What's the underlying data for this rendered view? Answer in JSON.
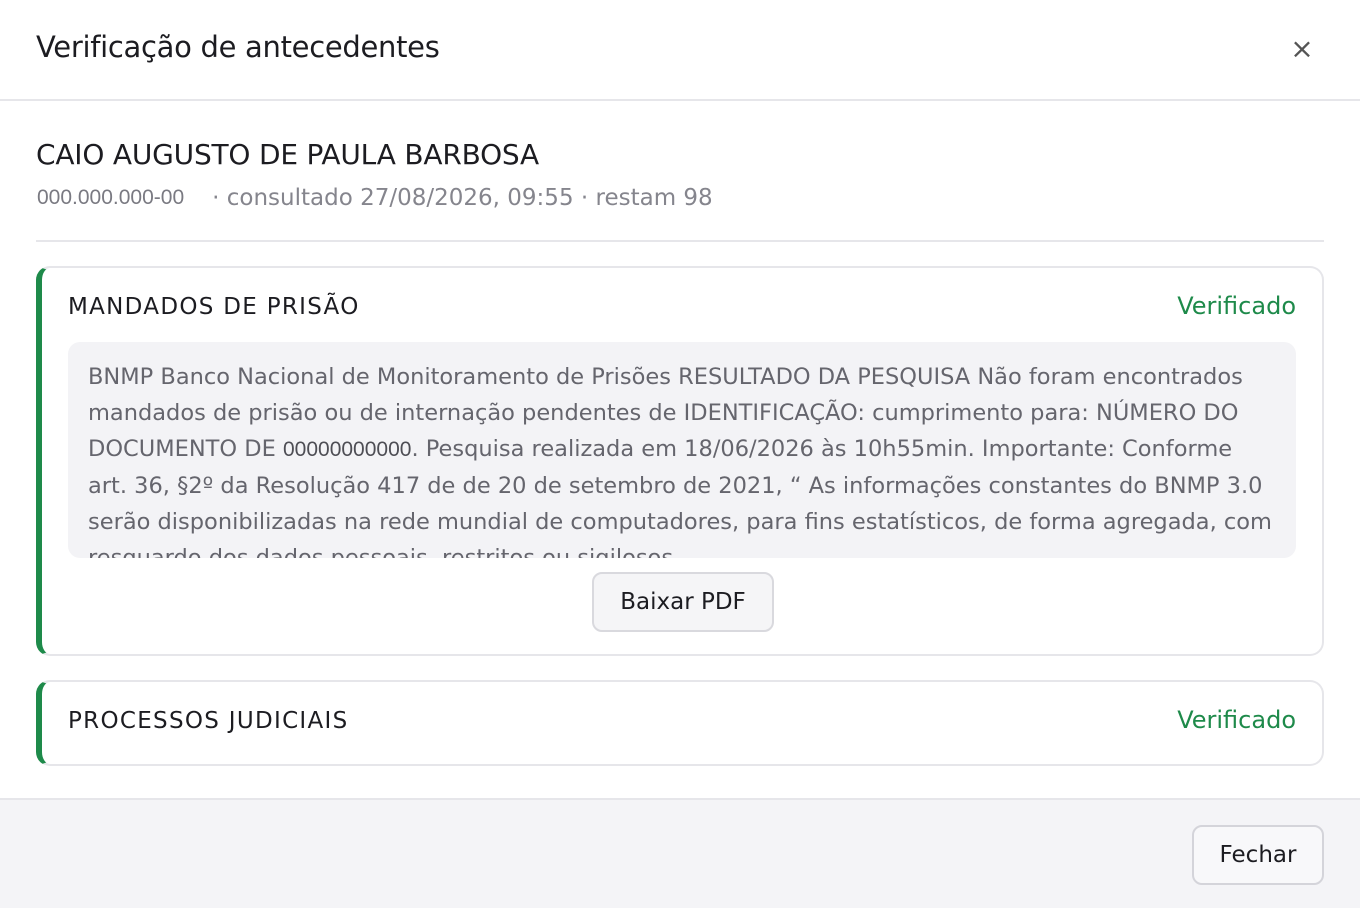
{
  "modal": {
    "title": "Verificação de antecedentes",
    "close_icon": "×"
  },
  "person": {
    "name": "CAIO AUGUSTO DE PAULA BARBOSA",
    "cpf": "000.000.000-00",
    "meta": "· consultado 27/08/2026, 09:55 · restam 98"
  },
  "sections": [
    {
      "title": "MANDADOS DE PRISÃO",
      "status": "Verificado",
      "status_color": "#1e8a4a",
      "result_part1": "BNMP Banco Nacional de Monitoramento de Prisões RESULTADO DA PESQUISA Não foram encontrados mandados de prisão ou de internação pendentes de IDENTIFICAÇÃO: cumprimento para: NÚMERO DO DOCUMENTO DE ",
      "result_doc_number": "00000000000",
      "result_part2": ".     Pesquisa realizada em 18/06/2026 às 10h55min. Importante: Conforme art. 36, §2º da Resolução 417 de de 20 de setembro de 2021, “ As informações constantes do BNMP 3.0 serão disponibilizadas na rede mundial de computadores, para fins estatísticos, de forma agregada, com resguardo dos dados pessoais, restritos ou sigilosos",
      "download_label": "Baixar PDF"
    },
    {
      "title": "PROCESSOS JUDICIAIS",
      "status": "Verificado",
      "status_color": "#1e8a4a"
    }
  ],
  "footer": {
    "close_label": "Fechar"
  }
}
